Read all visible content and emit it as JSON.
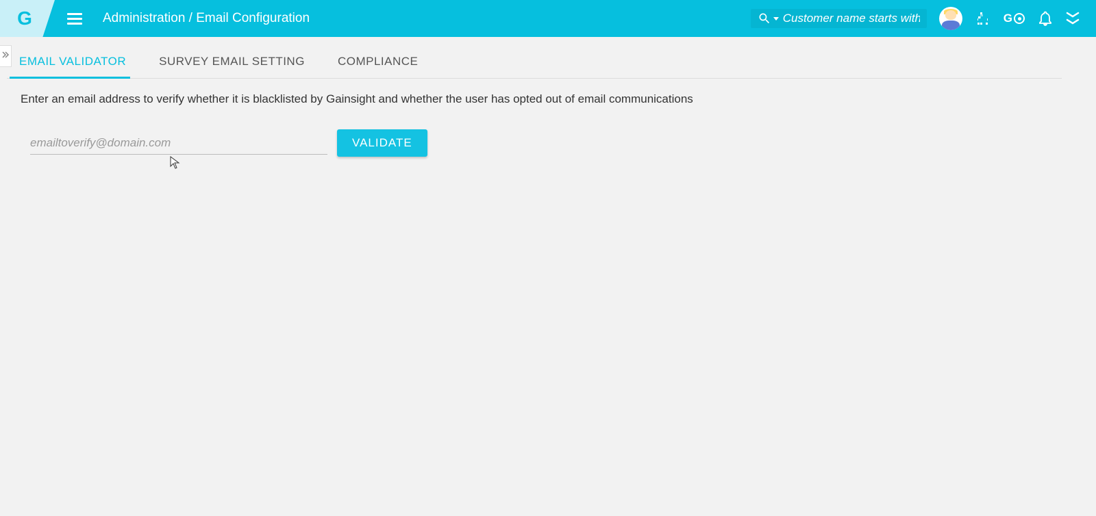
{
  "header": {
    "logo_letter": "G",
    "breadcrumb": "Administration / Email Configuration",
    "search_placeholder": "Customer name starts with",
    "go_label": "G"
  },
  "tabs": [
    {
      "label": "EMAIL VALIDATOR",
      "active": true
    },
    {
      "label": "SURVEY EMAIL SETTING",
      "active": false
    },
    {
      "label": "COMPLIANCE",
      "active": false
    }
  ],
  "main": {
    "description": "Enter an email address to verify whether it is blacklisted by Gainsight and whether the user has opted out of email communications",
    "email_placeholder": "emailtoverify@domain.com",
    "validate_label": "VALIDATE"
  }
}
